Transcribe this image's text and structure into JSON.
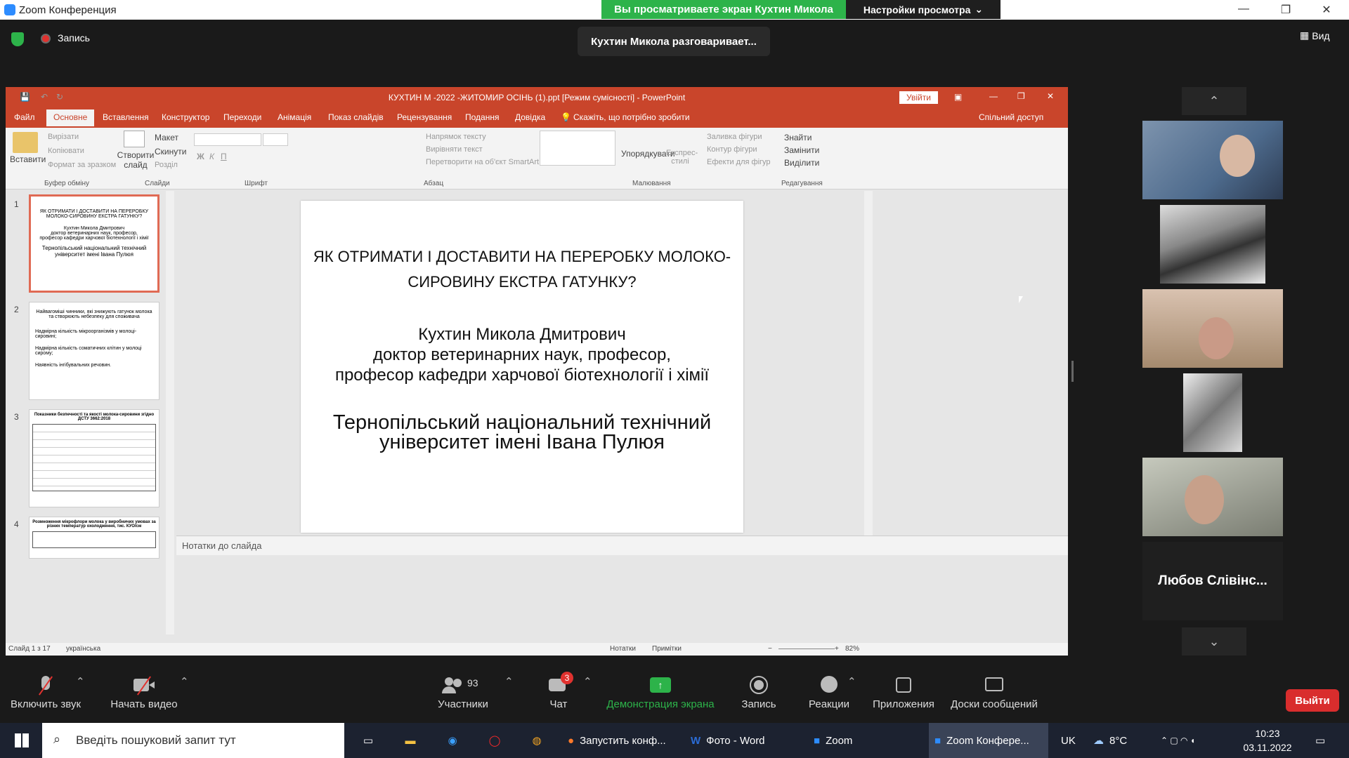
{
  "zoom_window": {
    "title": "Zoom Конференция",
    "share_banner": "Вы просматриваете экран Кухтин Микола",
    "view_settings": "Настройки просмотра",
    "recording_label": "Запись",
    "speaking_indicator": "Кухтин Микола разговаривает...",
    "view_button": "Вид"
  },
  "powerpoint": {
    "title": "КУХТИН М -2022 -ЖИТОМИР ОСІНЬ (1).ppt [Режим сумісності] - PowerPoint",
    "sign_in": "Увійти",
    "tabs": [
      "Файл",
      "Основне",
      "Вставлення",
      "Конструктор",
      "Переходи",
      "Анімація",
      "Показ слайдів",
      "Рецензування",
      "Подання",
      "Довідка"
    ],
    "active_tab": "Основне",
    "tell_me": "Скажіть, що потрібно зробити",
    "share": "Спільний доступ",
    "ribbon": {
      "paste": "Вставити",
      "cut": "Вирізати",
      "copy": "Копіювати",
      "format_painter": "Формат за зразком",
      "new_slide": "Створити слайд",
      "layout": "Макет",
      "reset": "Скинути",
      "section": "Розділ",
      "text_direction": "Напрямок тексту",
      "align_text": "Вирівняти текст",
      "convert_smartart": "Перетворити на об'єкт SmartArt",
      "arrange": "Упорядкувати",
      "quick_styles": "Експрес-стилі",
      "shape_fill": "Заливка фігури",
      "shape_outline": "Контур фігури",
      "shape_effects": "Ефекти для фігур",
      "find": "Знайти",
      "replace": "Замінити",
      "select": "Виділити",
      "groups": {
        "clipboard": "Буфер обміну",
        "slides": "Слайди",
        "font": "Шрифт",
        "paragraph": "Абзац",
        "drawing": "Малювання",
        "editing": "Редагування"
      }
    },
    "thumbnails": [
      {
        "num": "1",
        "lines": [
          "ЯК ОТРИМАТИ І ДОСТАВИТИ НА ПЕРЕРОБКУ МОЛОКО-СИРОВИНУ ЕКСТРА ГАТУНКУ?",
          "Кухтин Микола Дмитрович",
          "доктор ветеринарних наук, професор,",
          "професор кафедри харчової біотехнології і хімії",
          "Тернопільський національний технічний університет імені Івана Пулюя"
        ]
      },
      {
        "num": "2",
        "lines": [
          "Найвагоміші чинники, які знижують гатунок молока та створюють небезпеку для споживача",
          "Надмірна кількість мікроорганізмів у молоці-сировині;",
          "Надмірна кількість соматичних клітин у молоці сирому;",
          "Наявність інгібувальних речовин."
        ]
      },
      {
        "num": "3",
        "lines": [
          "Показники безпечності та якості молока-сировини згідно ДСТУ 3662:2018"
        ]
      },
      {
        "num": "4",
        "lines": [
          "Розмноження мікрофлори молока у виробничих умовах за різних температур охолодження, тис. КУО/см"
        ]
      }
    ],
    "slide": {
      "title_line1": "ЯК ОТРИМАТИ І ДОСТАВИТИ НА ПЕРЕРОБКУ МОЛОКО-",
      "title_line2": "СИРОВИНУ ЕКСТРА ГАТУНКУ?",
      "author": "Кухтин Микола Дмитрович",
      "degree": "доктор ветеринарних наук, професор,",
      "position": "професор кафедри харчової біотехнології і хімії",
      "university_line1": "Тернопільський національний технічний",
      "university_line2": "університет імені Івана Пулюя"
    },
    "notes_placeholder": "Нотатки до слайда",
    "status": {
      "slide_count": "Слайд 1 з 17",
      "language": "українська",
      "notes": "Нотатки",
      "comments": "Примітки",
      "zoom": "82%"
    }
  },
  "participants": [
    {
      "name": ""
    },
    {
      "name": ""
    },
    {
      "name": ""
    },
    {
      "name": ""
    },
    {
      "name": ""
    },
    {
      "name": "Любов Слівінс..."
    }
  ],
  "toolbar": {
    "mute": "Включить звук",
    "video": "Начать видео",
    "participants": "Участники",
    "participants_count": "93",
    "chat": "Чат",
    "chat_badge": "3",
    "share_screen": "Демонстрация экрана",
    "record": "Запись",
    "reactions": "Реакции",
    "apps": "Приложения",
    "whiteboards": "Доски сообщений",
    "leave": "Выйти"
  },
  "taskbar": {
    "search_placeholder": "Введіть пошуковий запит тут",
    "tasks": [
      "Запустить конф...",
      "Фото - Word",
      "Zoom",
      "Zoom Конфере..."
    ],
    "language": "UK",
    "weather": "8°C",
    "time": "10:23",
    "date": "03.11.2022"
  }
}
